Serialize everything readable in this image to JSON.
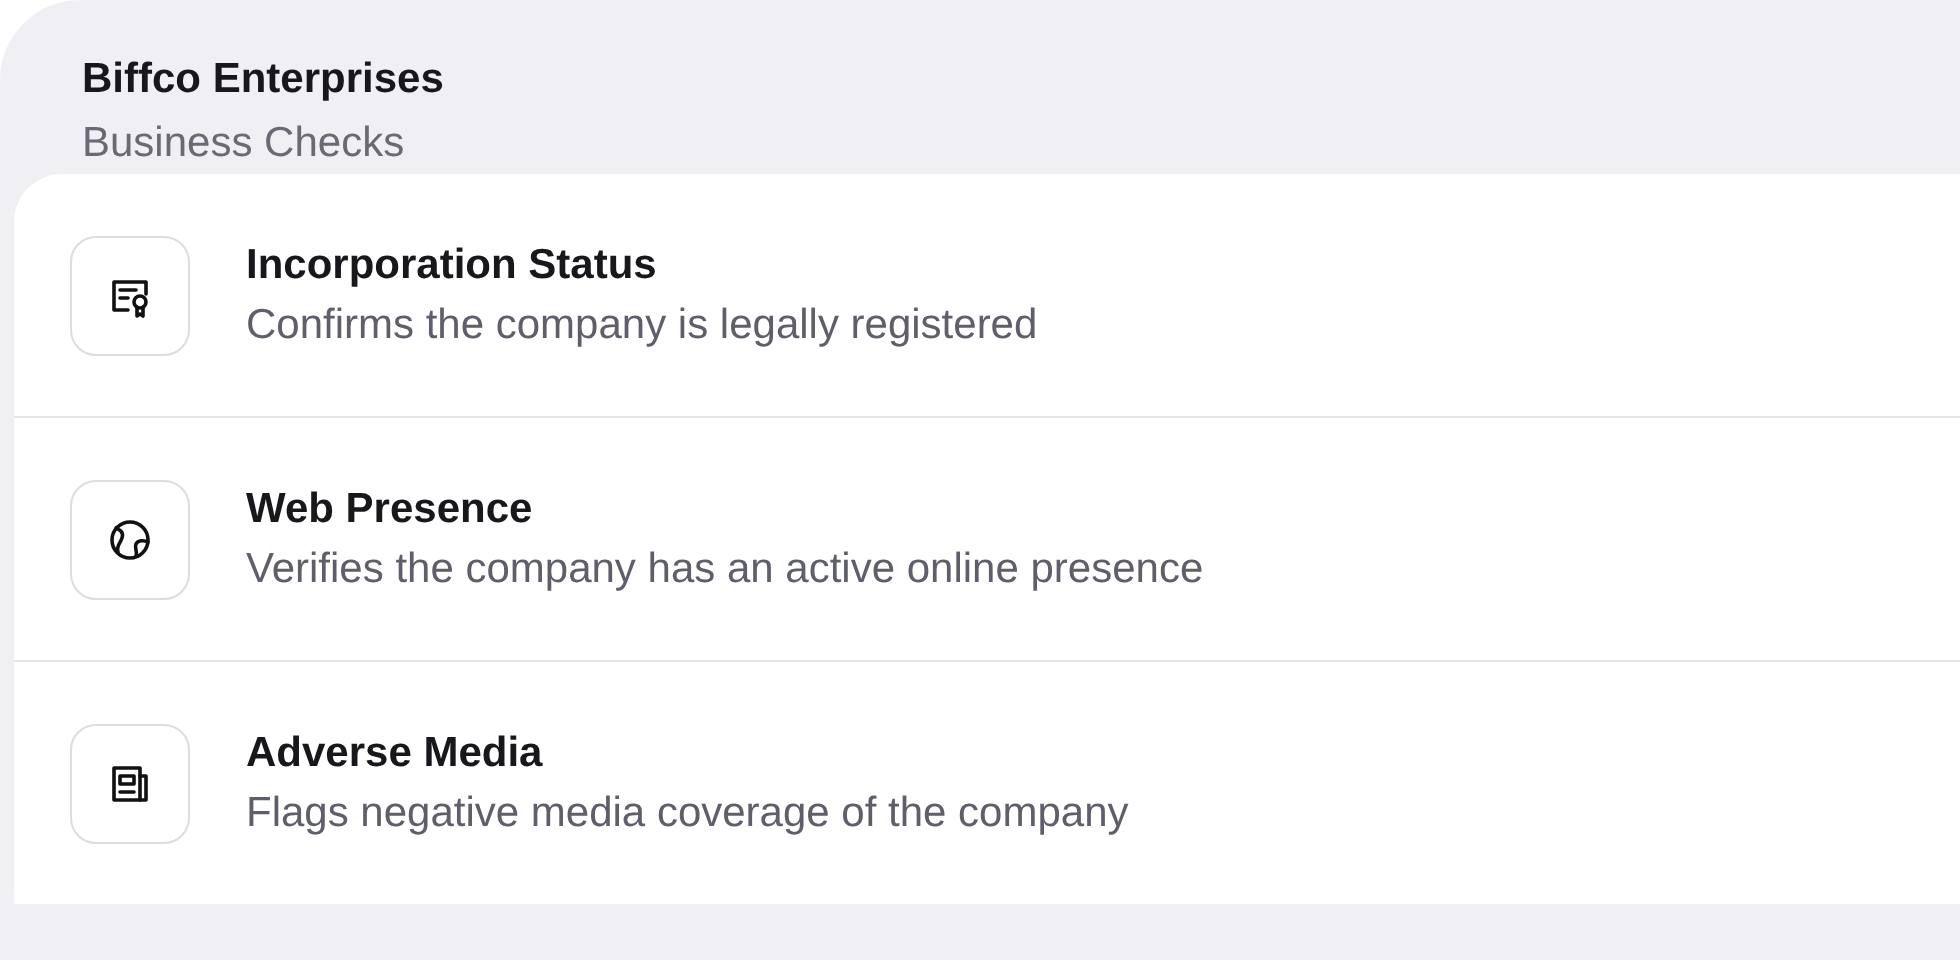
{
  "header": {
    "title": "Biffco Enterprises",
    "subtitle": "Business Checks"
  },
  "checks": [
    {
      "kind": "certificate",
      "title": "Incorporation Status",
      "description": "Confirms the company is legally registered"
    },
    {
      "kind": "globe",
      "title": "Web Presence",
      "description": "Verifies the company has an active online presence"
    },
    {
      "kind": "newspaper",
      "title": "Adverse Media",
      "description": "Flags negative media coverage of the company"
    }
  ]
}
